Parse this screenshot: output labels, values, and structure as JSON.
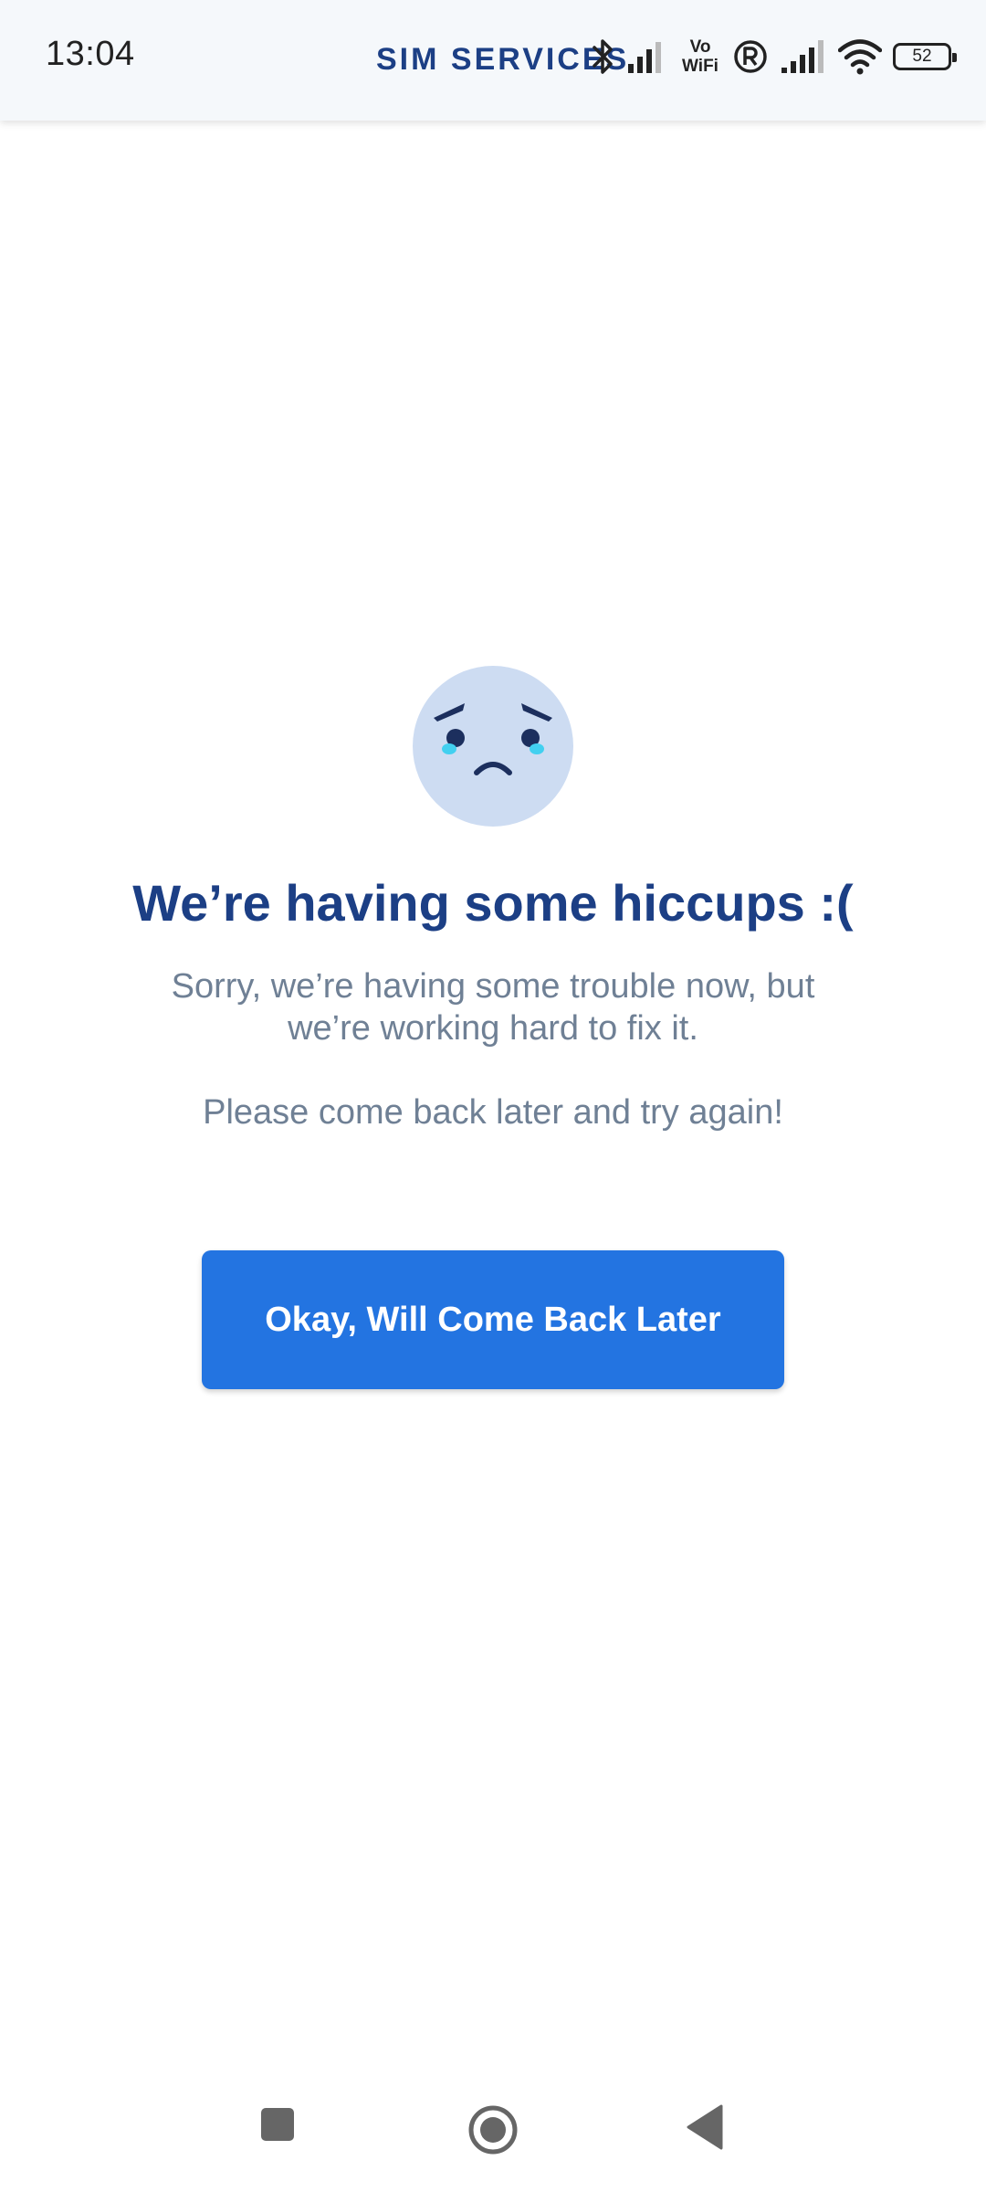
{
  "status_bar": {
    "time": "13:04",
    "vowifi_line1": "Vo",
    "vowifi_line2": "WiFi",
    "battery_level": "52"
  },
  "app_bar": {
    "title": "SIM SERVICES"
  },
  "error": {
    "headline": "We’re having some hiccups :(",
    "message": "Sorry, we’re having some trouble now, but we’re working hard to fix it.",
    "message_secondary": "Please come back later and try again!",
    "button_label": "Okay, Will Come Back Later"
  },
  "colors": {
    "brand_dark_blue": "#1c3f85",
    "button_blue": "#2374e1",
    "body_text_gray": "#6f8095",
    "face_fill": "#cddcf2",
    "tear_cyan": "#42d0f0"
  },
  "icons": {
    "status": [
      "bluetooth-icon",
      "signal-icon",
      "vowifi-icon",
      "roaming-icon",
      "signal-icon",
      "wifi-icon",
      "battery-icon"
    ],
    "navigation": [
      "recents-icon",
      "home-icon",
      "back-icon"
    ],
    "illustration": "sad-face-icon"
  }
}
